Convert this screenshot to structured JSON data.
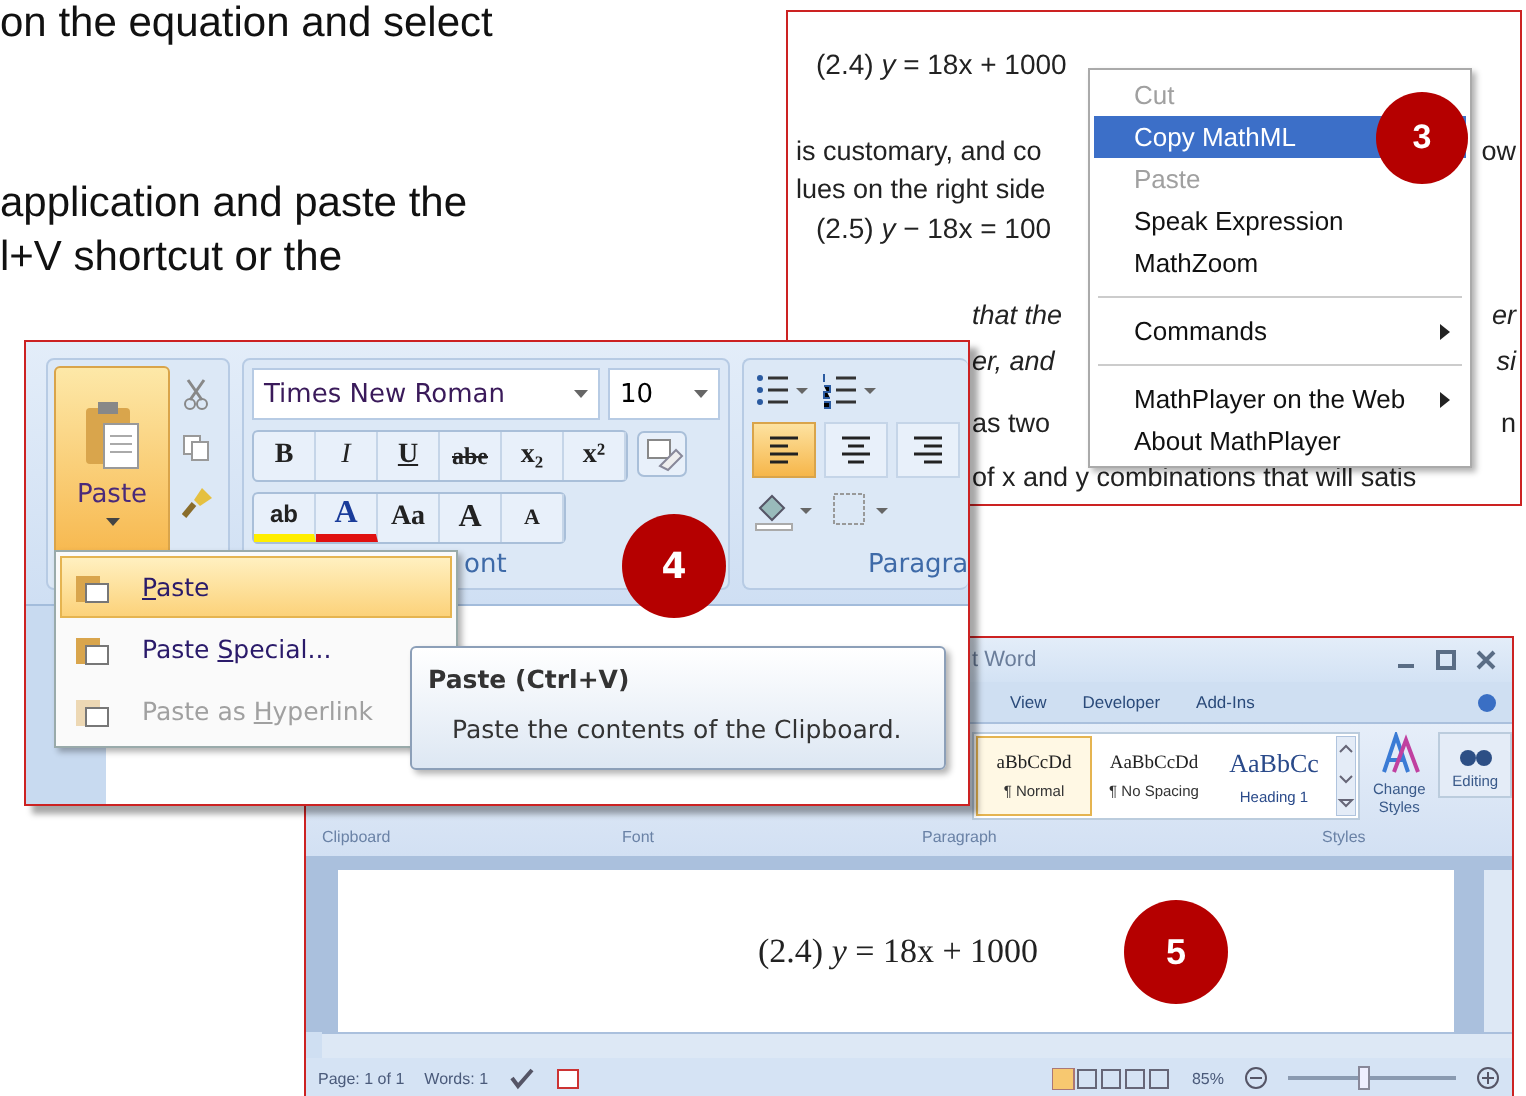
{
  "instructions": [
    "on the equation and select",
    "application and paste the",
    "l+V shortcut or the"
  ],
  "step3": {
    "badge": "3",
    "document_lines": [
      {
        "kind": "equation",
        "left": "(2.4) *y* = 18x + 1000",
        "italic": false
      },
      {
        "kind": "text",
        "left": "is customary, and co",
        "right": "ow",
        "italic": false
      },
      {
        "kind": "text",
        "left": "lues on the right side",
        "italic": false
      },
      {
        "kind": "equation",
        "left": "(2.5) *y* − 18x = 100",
        "italic": false
      },
      {
        "kind": "partial",
        "left": "that the",
        "right": "er",
        "italic": true
      },
      {
        "kind": "partial",
        "left": "er, and",
        "right": "si",
        "italic": true
      },
      {
        "kind": "partial",
        "left": "as two",
        "right": "n",
        "italic": false
      },
      {
        "kind": "partial",
        "left": "of x and y combinations that will satis",
        "italic": false
      }
    ],
    "context_menu": [
      {
        "kind": "item",
        "label": "Cut",
        "disabled": true,
        "selected": false,
        "submenu": false
      },
      {
        "kind": "item",
        "label": "Copy MathML",
        "disabled": false,
        "selected": true,
        "submenu": false
      },
      {
        "kind": "item",
        "label": "Paste",
        "disabled": true,
        "selected": false,
        "submenu": false
      },
      {
        "kind": "item",
        "label": "Speak Expression",
        "disabled": false,
        "selected": false,
        "submenu": false
      },
      {
        "kind": "item",
        "label": "MathZoom",
        "disabled": false,
        "selected": false,
        "submenu": false
      },
      {
        "kind": "separator"
      },
      {
        "kind": "item",
        "label": "Commands",
        "disabled": false,
        "selected": false,
        "submenu": true
      },
      {
        "kind": "separator"
      },
      {
        "kind": "item",
        "label": "MathPlayer on the Web",
        "disabled": false,
        "selected": false,
        "submenu": true
      },
      {
        "kind": "item",
        "label": "About MathPlayer",
        "disabled": false,
        "selected": false,
        "submenu": false
      }
    ]
  },
  "step4": {
    "badge": "4",
    "paste_label": "Paste",
    "font_name": "Times New Roman",
    "font_size": "10",
    "format_buttons": [
      "B",
      "I",
      "U",
      "abe",
      "x₂",
      "x²"
    ],
    "font_color_buttons": [
      "ab",
      "A",
      "Aa",
      "A",
      "A"
    ],
    "font_group_label": "ont",
    "paragraph_group_label": "Paragra",
    "align_buttons": [
      {
        "selected": true
      },
      {
        "selected": false
      },
      {
        "selected": false
      }
    ],
    "paste_menu": [
      {
        "key": "P",
        "after": "aste",
        "selected": true,
        "disabled": false
      },
      {
        "before": "Paste ",
        "key": "S",
        "after": "pecial...",
        "selected": false,
        "disabled": false
      },
      {
        "before": "Paste as ",
        "key": "H",
        "after": "yperlink",
        "selected": false,
        "disabled": true
      }
    ],
    "tooltip": {
      "title": "Paste (Ctrl+V)",
      "text": "Paste the contents of the Clipboard."
    }
  },
  "step5": {
    "badge": "5",
    "title": "t Word",
    "tabs": [
      "View",
      "Developer",
      "Add-Ins"
    ],
    "styles": [
      {
        "preview": "aBbCcDd",
        "name": "¶ Normal",
        "selected": true
      },
      {
        "preview": "AaBbCcDd",
        "name": "¶ No Spacing",
        "selected": false
      },
      {
        "preview": "AaBbCc",
        "name": "Heading 1",
        "selected": false
      }
    ],
    "change_styles": "Change Styles",
    "editing": "Editing",
    "group_labels": [
      "Clipboard",
      "Font",
      "Paragraph",
      "Styles"
    ],
    "equation": "(2.4) *y* = 18x + 1000",
    "status": [
      "Page: 1 of 1",
      "Words: 1"
    ],
    "zoom": "85%",
    "zoom_slider": {
      "level": 0.45
    }
  }
}
